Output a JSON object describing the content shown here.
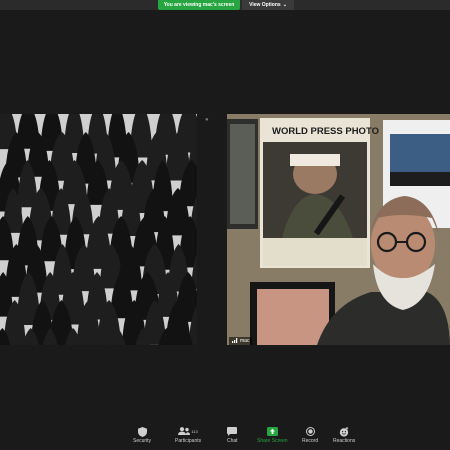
{
  "header": {
    "viewing_notice": "You are viewing mac's screen",
    "view_options_label": "View Options",
    "view_options_caret": "⌄"
  },
  "video": {
    "participant_name": "mac",
    "poster_title": "WORLD PRESS PHOTO"
  },
  "toolbar": {
    "items": [
      {
        "label": "Security",
        "icon": "shield-icon"
      },
      {
        "label": "Participants",
        "icon": "participants-icon",
        "count": "113"
      },
      {
        "label": "Chat",
        "icon": "chat-icon"
      },
      {
        "label": "Share Screen",
        "icon": "share-screen-icon"
      },
      {
        "label": "Record",
        "icon": "record-icon"
      },
      {
        "label": "Reactions",
        "icon": "reactions-icon"
      }
    ],
    "accent_color": "#26a541"
  }
}
